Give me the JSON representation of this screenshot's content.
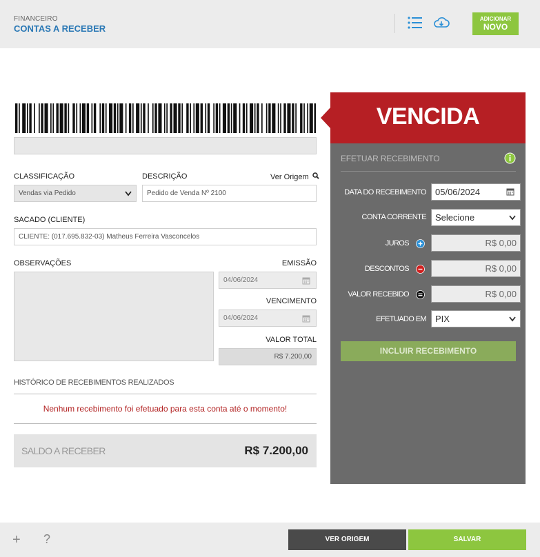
{
  "header": {
    "subtitle": "FINANCEIRO",
    "title": "CONTAS A RECEBER",
    "list_icon": "list-icon",
    "cloud_icon": "cloud-download-icon",
    "add_button_line1": "ADICIONAR",
    "add_button_line2": "NOVO"
  },
  "form": {
    "classificacao_label": "CLASSIFICAÇÃO",
    "classificacao_value": "Vendas via Pedido",
    "descricao_label": "DESCRIÇÃO",
    "ver_origem_link": "Ver Origem",
    "descricao_value": "Pedido de Venda Nº 2100",
    "sacado_label": "SACADO (CLIENTE)",
    "sacado_value": "CLIENTE: (017.695.832-03) Matheus Ferreira Vasconcelos",
    "observacoes_label": "OBSERVAÇÕES",
    "emissao_label": "EMISSÃO",
    "emissao_value": "04/06/2024",
    "vencimento_label": "VENCIMENTO",
    "vencimento_value": "04/06/2024",
    "valor_total_label": "VALOR TOTAL",
    "valor_total_value": "R$ 7.200,00"
  },
  "historico": {
    "title": "HISTÓRICO DE RECEBIMENTOS REALIZADOS",
    "empty_message": "Nenhum recebimento foi efetuado para esta conta até o momento!",
    "saldo_label": "SALDO A RECEBER",
    "saldo_value": "R$ 7.200,00"
  },
  "panel": {
    "status": "VENCIDA",
    "section_title": "EFETUAR RECEBIMENTO",
    "data_label": "DATA DO RECEBIMENTO",
    "data_value": "05/06/2024",
    "conta_label": "CONTA CORRENTE",
    "conta_value": "Selecione",
    "juros_label": "JUROS",
    "juros_value": "R$ 0,00",
    "descontos_label": "DESCONTOS",
    "descontos_value": "R$ 0,00",
    "valor_recebido_label": "VALOR RECEBIDO",
    "valor_recebido_value": "R$ 0,00",
    "efetuado_label": "EFETUADO EM",
    "efetuado_value": "PIX",
    "incluir_button": "INCLUIR RECEBIMENTO"
  },
  "footer": {
    "add_icon": "+",
    "help_icon": "?",
    "ver_origem_button": "VER ORIGEM",
    "salvar_button": "SALVAR"
  },
  "colors": {
    "accent_blue": "#2a78b5",
    "green": "#8dc63f",
    "status_red": "#b61f24",
    "panel_grey": "#6b6b6b"
  }
}
